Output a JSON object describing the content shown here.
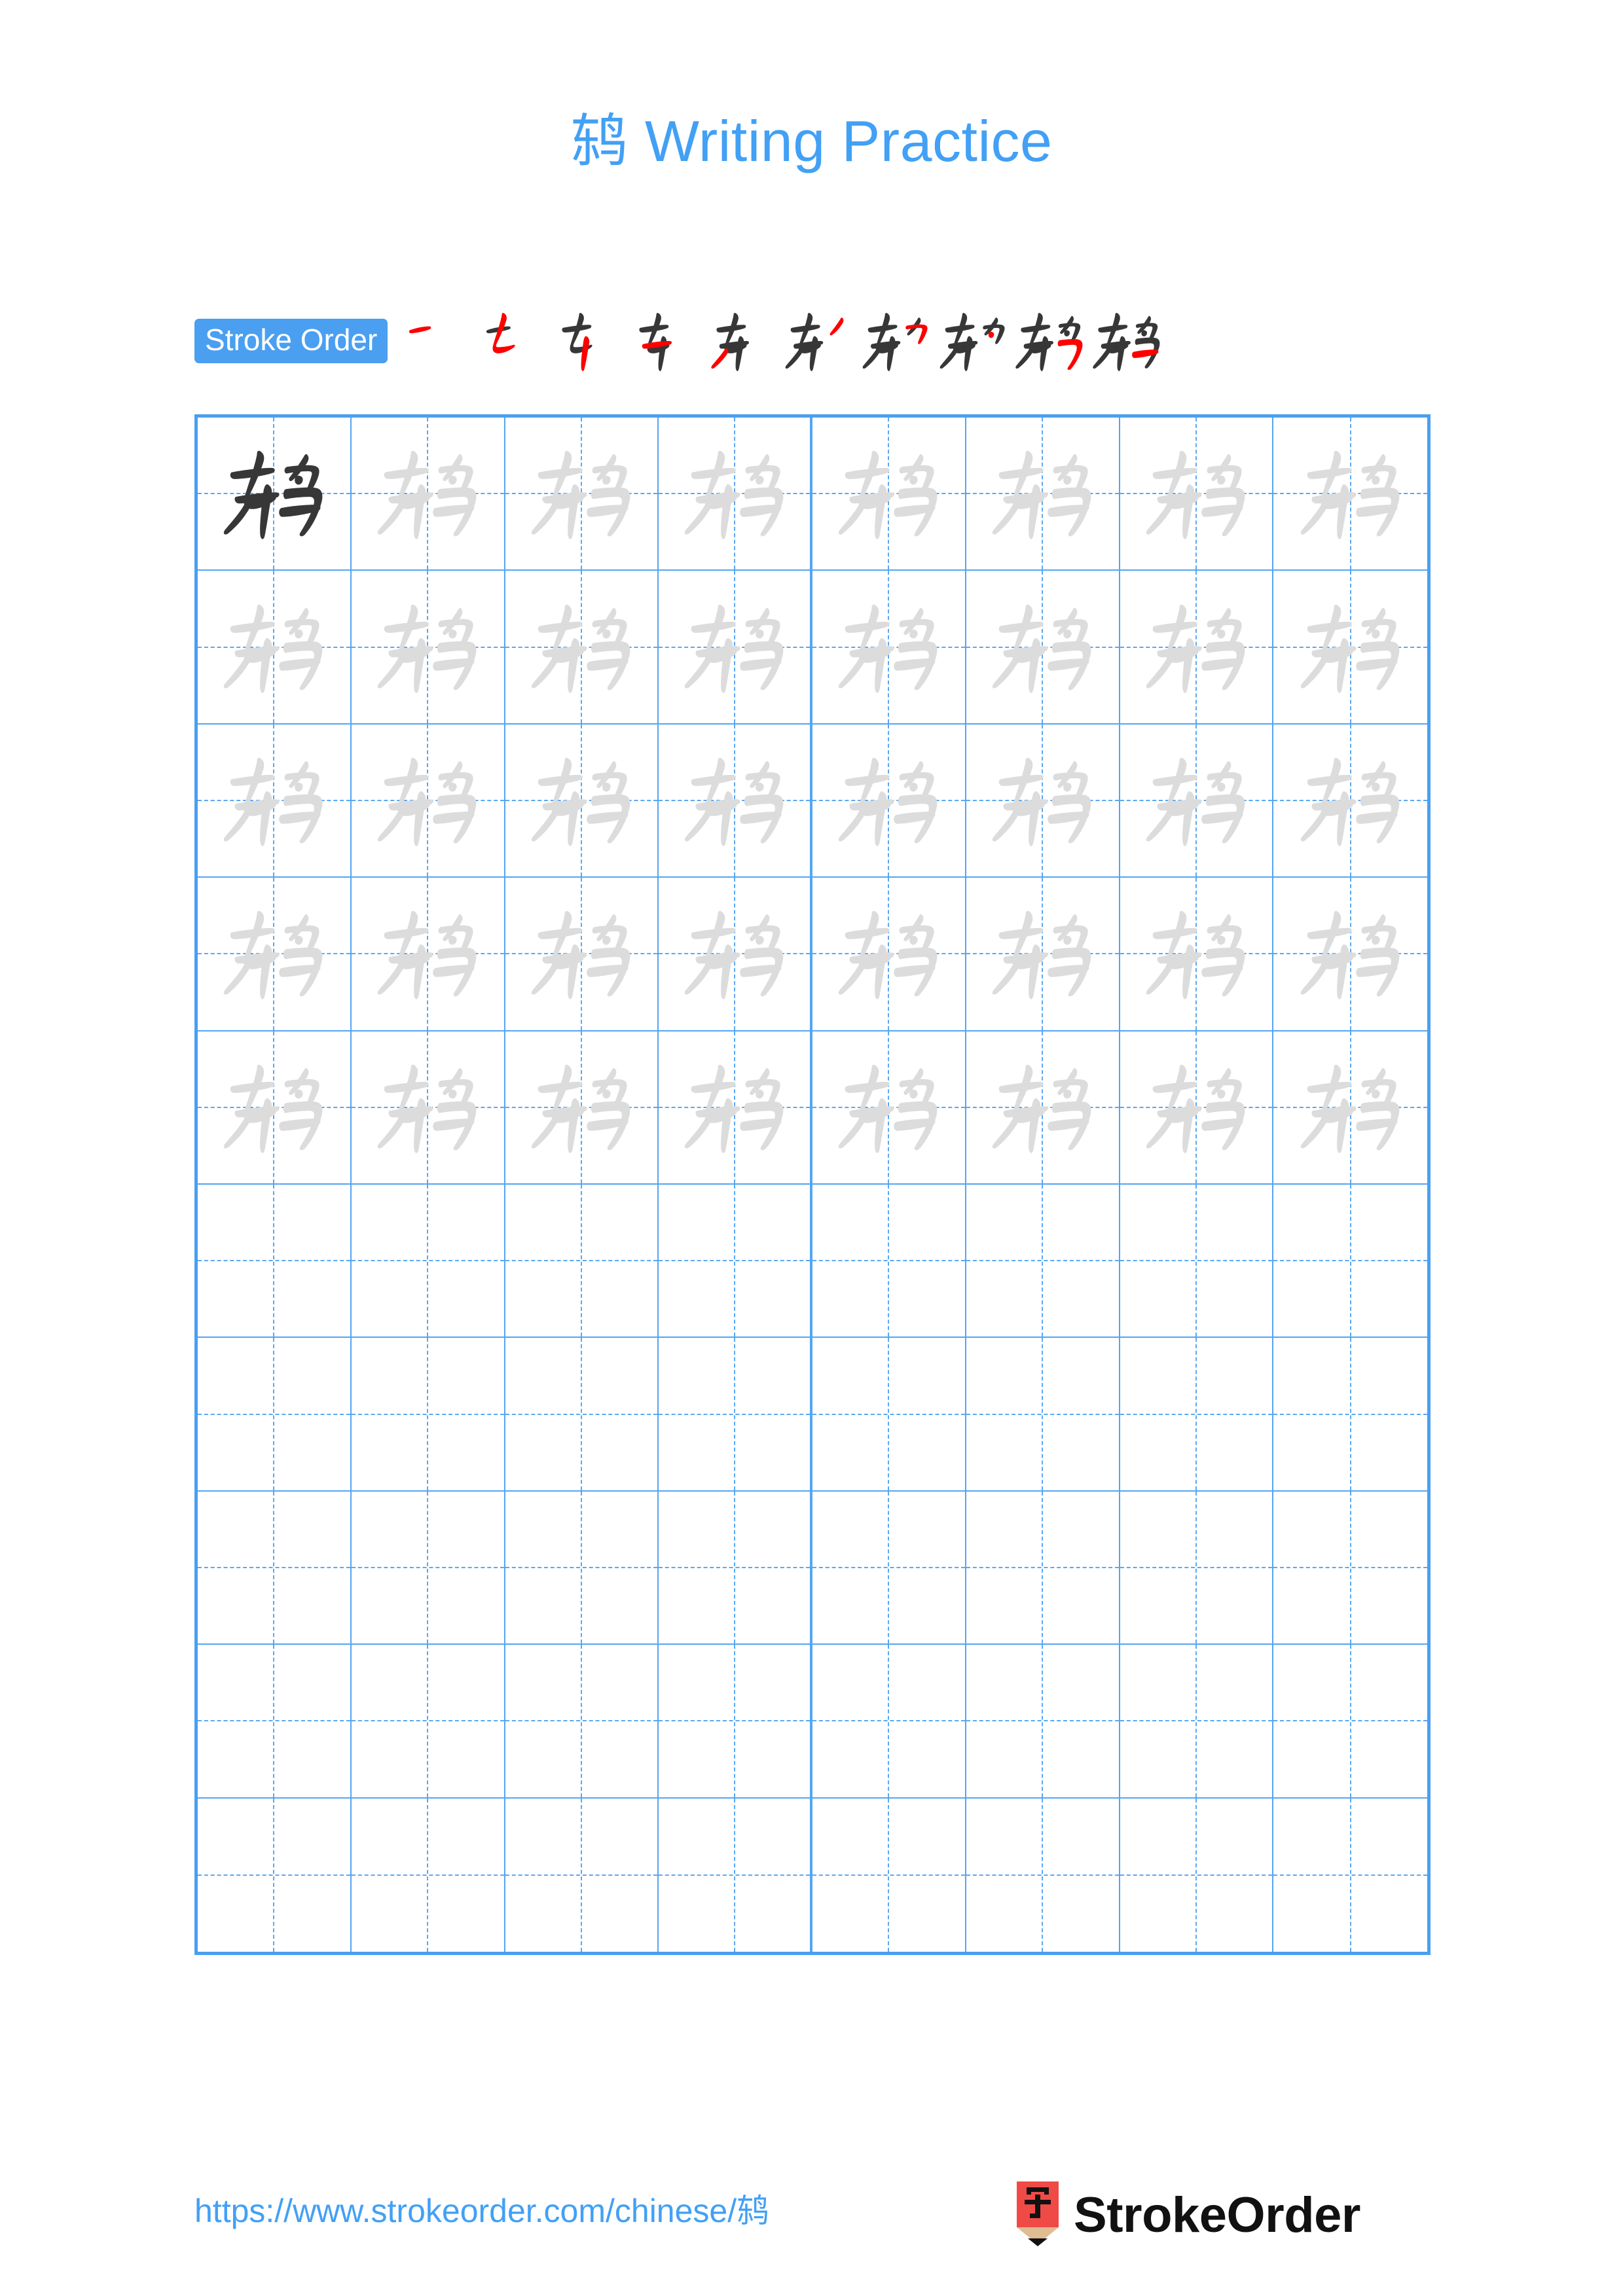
{
  "page": {
    "character": "鸫",
    "title": "鸫 Writing Practice",
    "background_color": "#ffffff",
    "accent_color": "#42a0f5",
    "grid_line_color": "#4a9ff0",
    "trace_glyph_color": "#dcdcdc",
    "model_glyph_color": "#373737"
  },
  "stroke_order": {
    "label": "Stroke Order",
    "badge_background": "#4a9ff0",
    "badge_text_color": "#ffffff",
    "new_stroke_color": "#ff0000",
    "previous_stroke_color": "#373737",
    "total_strokes": 10,
    "steps": [
      {
        "index": 1,
        "partial": "一"
      },
      {
        "index": 2,
        "partial": "七"
      },
      {
        "index": 3,
        "partial": "专"
      },
      {
        "index": 4,
        "partial": "夯"
      },
      {
        "index": 5,
        "partial": "东"
      },
      {
        "index": 6,
        "partial": "东丿"
      },
      {
        "index": 7,
        "partial": "东勹"
      },
      {
        "index": 8,
        "partial": "东勺"
      },
      {
        "index": 9,
        "partial": "鸫"
      },
      {
        "index": 10,
        "partial": "鸫"
      }
    ]
  },
  "practice_grid": {
    "columns": 8,
    "rows": 10,
    "filled_rows": 5,
    "empty_rows": 5,
    "cells": [
      [
        "model",
        "trace",
        "trace",
        "trace",
        "trace",
        "trace",
        "trace",
        "trace"
      ],
      [
        "trace",
        "trace",
        "trace",
        "trace",
        "trace",
        "trace",
        "trace",
        "trace"
      ],
      [
        "trace",
        "trace",
        "trace",
        "trace",
        "trace",
        "trace",
        "trace",
        "trace"
      ],
      [
        "trace",
        "trace",
        "trace",
        "trace",
        "trace",
        "trace",
        "trace",
        "trace"
      ],
      [
        "trace",
        "trace",
        "trace",
        "trace",
        "trace",
        "trace",
        "trace",
        "trace"
      ],
      [
        "empty",
        "empty",
        "empty",
        "empty",
        "empty",
        "empty",
        "empty",
        "empty"
      ],
      [
        "empty",
        "empty",
        "empty",
        "empty",
        "empty",
        "empty",
        "empty",
        "empty"
      ],
      [
        "empty",
        "empty",
        "empty",
        "empty",
        "empty",
        "empty",
        "empty",
        "empty"
      ],
      [
        "empty",
        "empty",
        "empty",
        "empty",
        "empty",
        "empty",
        "empty",
        "empty"
      ],
      [
        "empty",
        "empty",
        "empty",
        "empty",
        "empty",
        "empty",
        "empty",
        "empty"
      ]
    ]
  },
  "footer": {
    "url": "https://www.strokeorder.com/chinese/鸫",
    "brand_name": "StrokeOrder",
    "logo_character": "字",
    "logo_body_color": "#f04a47",
    "logo_wood_color": "#e0bc92",
    "logo_tip_color": "#111111"
  }
}
